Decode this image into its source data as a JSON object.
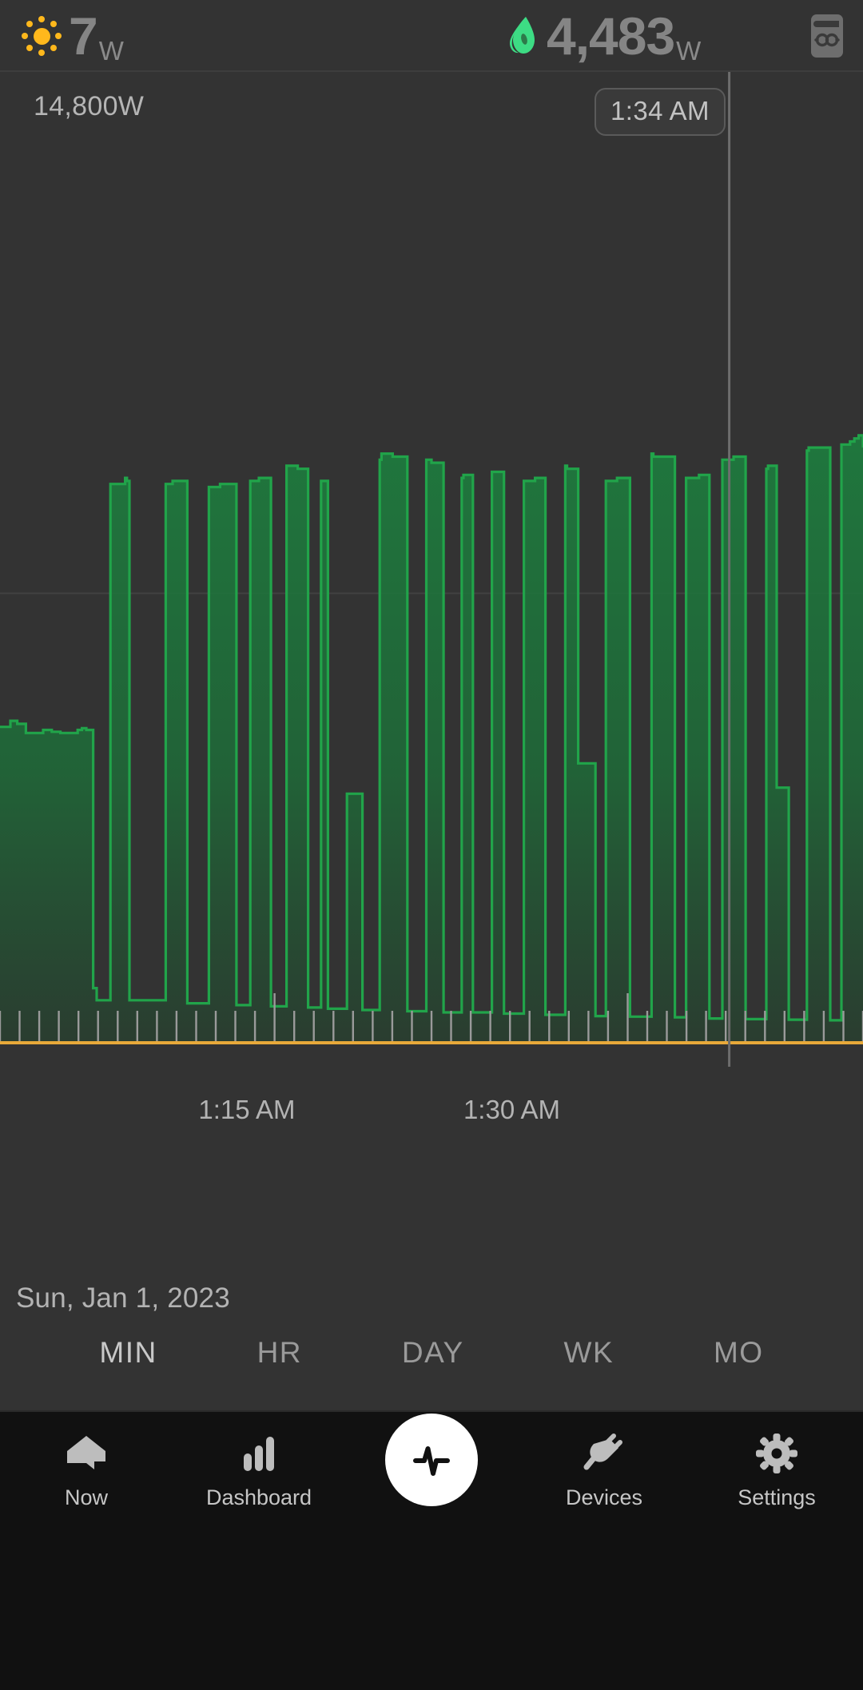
{
  "header": {
    "solar": {
      "icon": "sun-icon",
      "value": "7",
      "unit": "W",
      "color": "#FFB81C"
    },
    "grid": {
      "icon": "plug-icon",
      "value": "4,483",
      "unit": "W",
      "color": "#3ddc84"
    },
    "meter": {
      "icon": "utility-meter-icon",
      "color": "#6e6e6e"
    }
  },
  "chart_data": {
    "type": "area",
    "title": "",
    "xlabel": "",
    "ylabel": "",
    "y_axis_max_label": "14,800W",
    "ylim": [
      0,
      14800
    ],
    "gridline_values": [
      7400
    ],
    "grid": true,
    "legend": "none",
    "line_color": "#21a44a",
    "fill_color": "#1e6b38",
    "baseline_color": "#e8a93a",
    "cursor": {
      "time": "1:34 AM",
      "x_fraction": 0.845,
      "color": "#6d6d6d"
    },
    "date": "Sun, Jan 1, 2023",
    "x_tick_labels": [
      "1:15 AM",
      "1:30 AM"
    ],
    "x_tick_label_fractions": [
      0.23,
      0.537
    ],
    "x_minor_ticks": 44,
    "x_major_tick_fractions": [
      0.31,
      0.72
    ],
    "x_range_start": "1:08 AM",
    "x_range_end": "1:38 AM",
    "note": "Square-wave household load trace; values in watts sampled each ~40s across the visible window",
    "x": [
      0,
      0.004,
      0.012,
      0.02,
      0.03,
      0.04,
      0.05,
      0.06,
      0.07,
      0.08,
      0.09,
      0.095,
      0.1,
      0.105,
      0.108,
      0.112,
      0.125,
      0.128,
      0.13,
      0.145,
      0.147,
      0.15,
      0.165,
      0.167,
      0.19,
      0.192,
      0.2,
      0.215,
      0.217,
      0.225,
      0.24,
      0.242,
      0.255,
      0.272,
      0.274,
      0.288,
      0.29,
      0.3,
      0.312,
      0.314,
      0.33,
      0.332,
      0.345,
      0.355,
      0.357,
      0.37,
      0.372,
      0.378,
      0.38,
      0.39,
      0.4,
      0.402,
      0.41,
      0.418,
      0.42,
      0.432,
      0.44,
      0.442,
      0.455,
      0.47,
      0.472,
      0.48,
      0.492,
      0.494,
      0.5,
      0.512,
      0.514,
      0.525,
      0.535,
      0.537,
      0.548,
      0.555,
      0.557,
      0.57,
      0.582,
      0.584,
      0.595,
      0.605,
      0.607,
      0.62,
      0.63,
      0.632,
      0.645,
      0.655,
      0.657,
      0.67,
      0.678,
      0.68,
      0.69,
      0.7,
      0.702,
      0.715,
      0.728,
      0.73,
      0.745,
      0.755,
      0.757,
      0.77,
      0.782,
      0.784,
      0.795,
      0.81,
      0.812,
      0.822,
      0.835,
      0.837,
      0.85,
      0.862,
      0.864,
      0.875,
      0.888,
      0.89,
      0.9,
      0.912,
      0.914,
      0.925,
      0.935,
      0.937,
      0.95,
      0.962,
      0.964,
      0.975,
      0.985,
      0.99,
      0.995,
      1.0
    ],
    "y": [
      5200,
      5200,
      5300,
      5250,
      5100,
      5100,
      5150,
      5120,
      5100,
      5100,
      5150,
      5180,
      5150,
      5150,
      900,
      700,
      700,
      9200,
      9200,
      9300,
      9250,
      700,
      700,
      700,
      700,
      9200,
      9250,
      9250,
      650,
      650,
      650,
      9150,
      9200,
      9200,
      620,
      620,
      9250,
      9300,
      9300,
      600,
      600,
      9500,
      9450,
      9450,
      580,
      580,
      9250,
      9250,
      560,
      560,
      560,
      4100,
      4100,
      4100,
      540,
      540,
      9600,
      9700,
      9650,
      9650,
      520,
      520,
      520,
      9600,
      9550,
      9550,
      500,
      500,
      9300,
      9350,
      500,
      500,
      500,
      9400,
      9400,
      480,
      480,
      480,
      9250,
      9300,
      9300,
      460,
      460,
      9500,
      9450,
      4600,
      4600,
      4600,
      440,
      440,
      9250,
      9300,
      9300,
      430,
      430,
      9700,
      9650,
      9650,
      420,
      420,
      9300,
      9350,
      9350,
      400,
      400,
      9600,
      9650,
      9650,
      390,
      390,
      9450,
      9500,
      4200,
      4200,
      380,
      380,
      9750,
      9800,
      9800,
      370,
      370,
      9850,
      9900,
      9950,
      10000,
      9800
    ]
  },
  "periods": {
    "items": [
      {
        "label": "MIN",
        "active": true
      },
      {
        "label": "HR",
        "active": false
      },
      {
        "label": "DAY",
        "active": false
      },
      {
        "label": "WK",
        "active": false
      },
      {
        "label": "MO",
        "active": false
      }
    ]
  },
  "navbar": {
    "items": [
      {
        "label": "Now",
        "icon": "home-icon"
      },
      {
        "label": "Dashboard",
        "icon": "bar-chart-icon"
      },
      {
        "label": "",
        "icon": "pulse-icon"
      },
      {
        "label": "Devices",
        "icon": "plug-icon"
      },
      {
        "label": "Settings",
        "icon": "gear-icon"
      }
    ],
    "fab_icon": "pulse-icon"
  }
}
